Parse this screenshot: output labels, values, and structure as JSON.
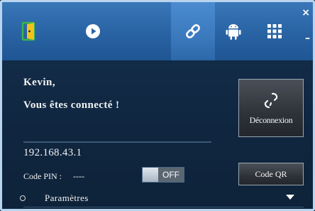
{
  "window": {
    "close_glyph": "×",
    "minimize_glyph": "–"
  },
  "toolbar": {
    "items": [
      {
        "icon": "exit-door-icon",
        "active": false
      },
      {
        "icon": "play-icon",
        "active": false
      },
      {
        "icon": "link-icon",
        "active": true
      },
      {
        "icon": "android-icon",
        "active": false
      },
      {
        "icon": "grid-apps-icon",
        "active": false
      }
    ]
  },
  "status": {
    "greeting": "Kevin,",
    "message": "Vous êtes connecté !"
  },
  "disconnect_button": {
    "label": "Déconnexion",
    "icon": "broken-link-icon"
  },
  "connection": {
    "ip_address": "192.168.43.1",
    "pin_label": "Code PIN :",
    "pin_value": "----",
    "pin_toggle_state": "OFF"
  },
  "qr_button": {
    "label": "Code QR"
  },
  "settings": {
    "label": "Paramètres",
    "icon": "chevron-down-icon"
  },
  "colors": {
    "toolbar": "#2b66a7",
    "toolbar_active": "#3b79bd",
    "background": "#102741",
    "button": "#2e3339",
    "icon_yellow": "#f2c21b",
    "icon_orange": "#e36b2c",
    "icon_green": "#39b54a"
  }
}
